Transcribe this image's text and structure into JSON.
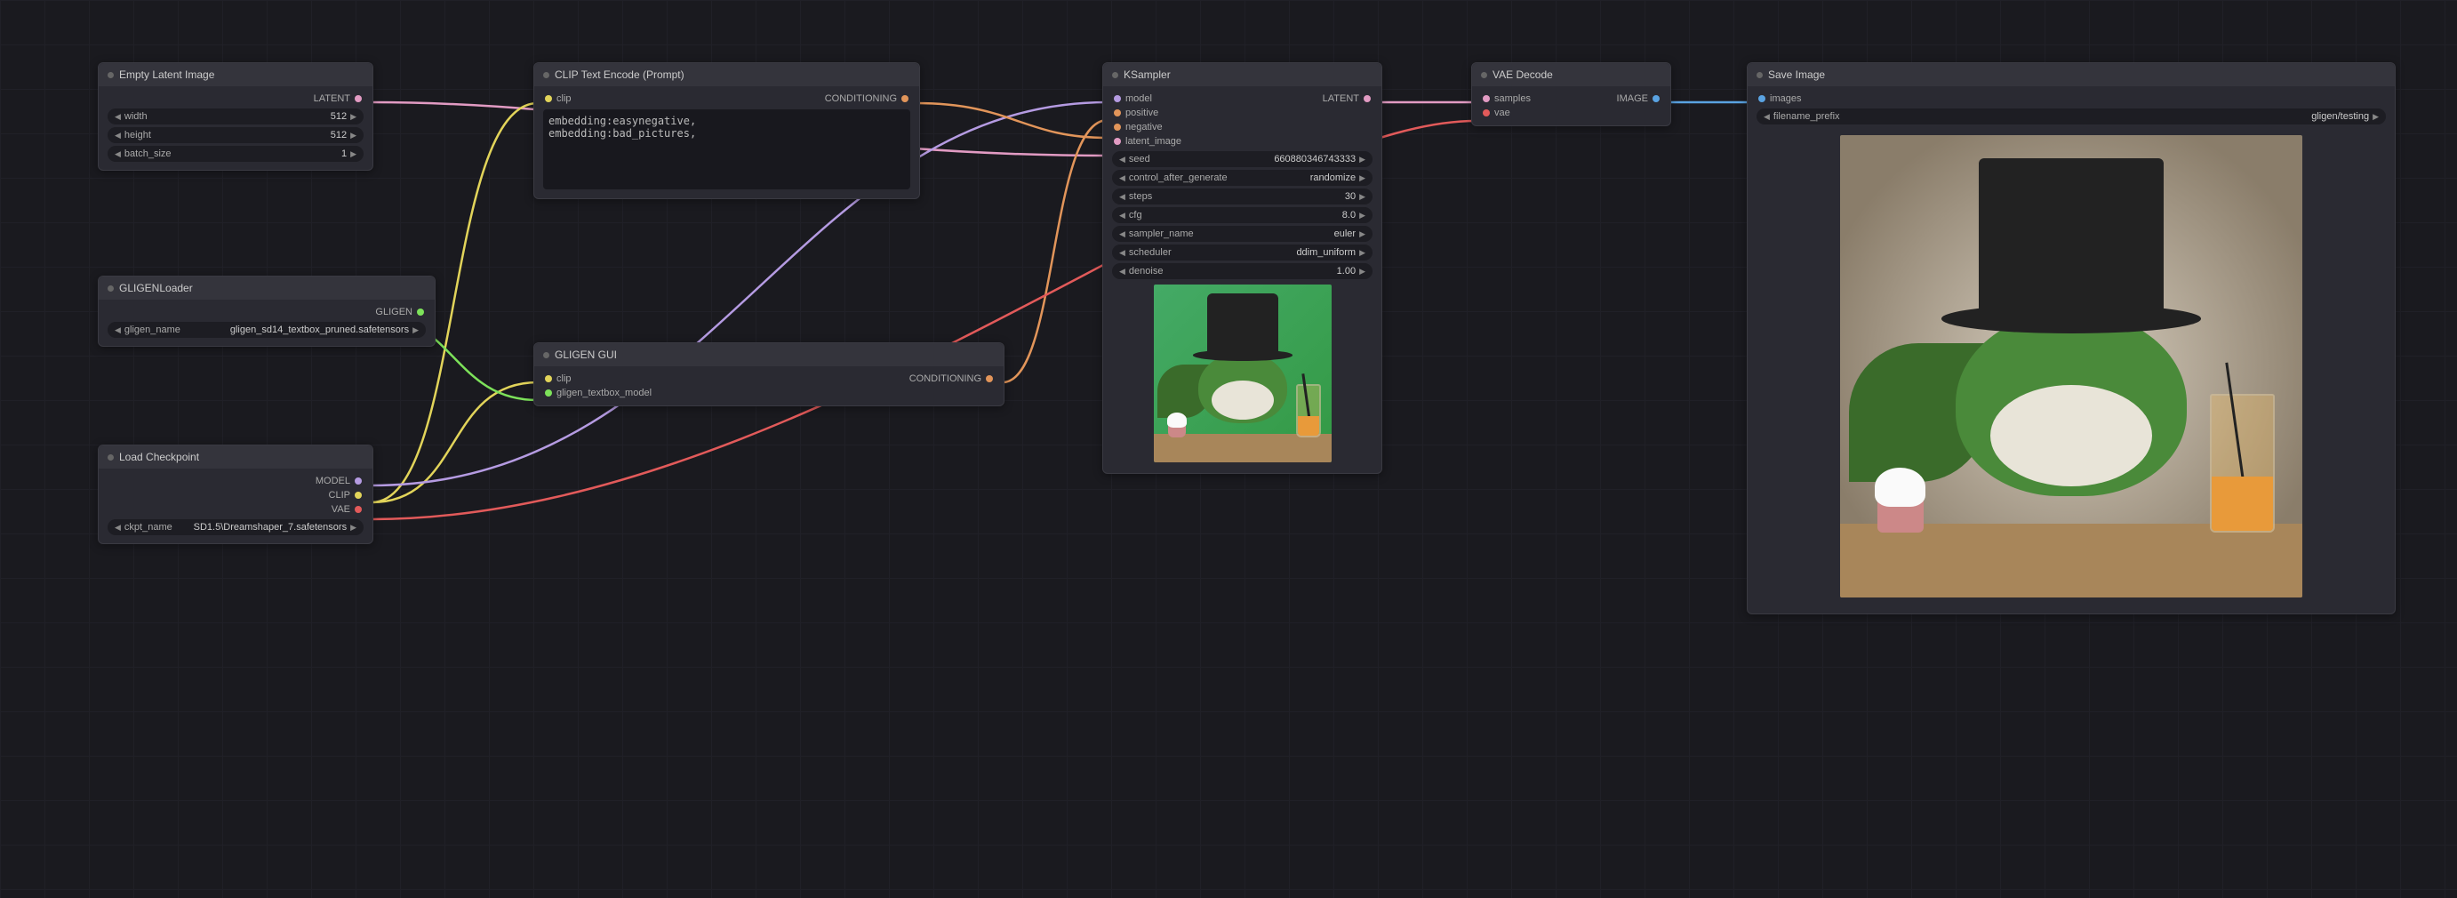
{
  "nodes": {
    "emptyLatent": {
      "title": "Empty Latent Image",
      "out_latent": "LATENT",
      "width_label": "width",
      "width_value": "512",
      "height_label": "height",
      "height_value": "512",
      "batch_label": "batch_size",
      "batch_value": "1"
    },
    "gligenLoader": {
      "title": "GLIGENLoader",
      "out_gligen": "GLIGEN",
      "name_label": "gligen_name",
      "name_value": "gligen_sd14_textbox_pruned.safetensors"
    },
    "loadCkpt": {
      "title": "Load Checkpoint",
      "out_model": "MODEL",
      "out_clip": "CLIP",
      "out_vae": "VAE",
      "ckpt_label": "ckpt_name",
      "ckpt_value": "SD1.5\\Dreamshaper_7.safetensors"
    },
    "clipText": {
      "title": "CLIP Text Encode (Prompt)",
      "in_clip": "clip",
      "out_cond": "CONDITIONING",
      "text": "embedding:easynegative,\nembedding:bad_pictures,"
    },
    "gligenGui": {
      "title": "GLIGEN GUI",
      "in_clip": "clip",
      "in_gligen": "gligen_textbox_model",
      "out_cond": "CONDITIONING"
    },
    "ksampler": {
      "title": "KSampler",
      "in_model": "model",
      "in_positive": "positive",
      "in_negative": "negative",
      "in_latent": "latent_image",
      "out_latent": "LATENT",
      "seed_label": "seed",
      "seed_value": "660880346743333",
      "ctrl_label": "control_after_generate",
      "ctrl_value": "randomize",
      "steps_label": "steps",
      "steps_value": "30",
      "cfg_label": "cfg",
      "cfg_value": "8.0",
      "sampler_label": "sampler_name",
      "sampler_value": "euler",
      "sched_label": "scheduler",
      "sched_value": "ddim_uniform",
      "denoise_label": "denoise",
      "denoise_value": "1.00"
    },
    "vaeDecode": {
      "title": "VAE Decode",
      "in_samples": "samples",
      "in_vae": "vae",
      "out_image": "IMAGE"
    },
    "saveImage": {
      "title": "Save Image",
      "in_images": "images",
      "prefix_label": "filename_prefix",
      "prefix_value": "gligen/testing"
    }
  },
  "colors": {
    "latent": "#e29bc3",
    "clip": "#e2d45a",
    "conditioning": "#e2955a",
    "model": "#b59be2",
    "vae": "#e25a5a",
    "gligen": "#7de25a",
    "image": "#5aa3e2"
  }
}
